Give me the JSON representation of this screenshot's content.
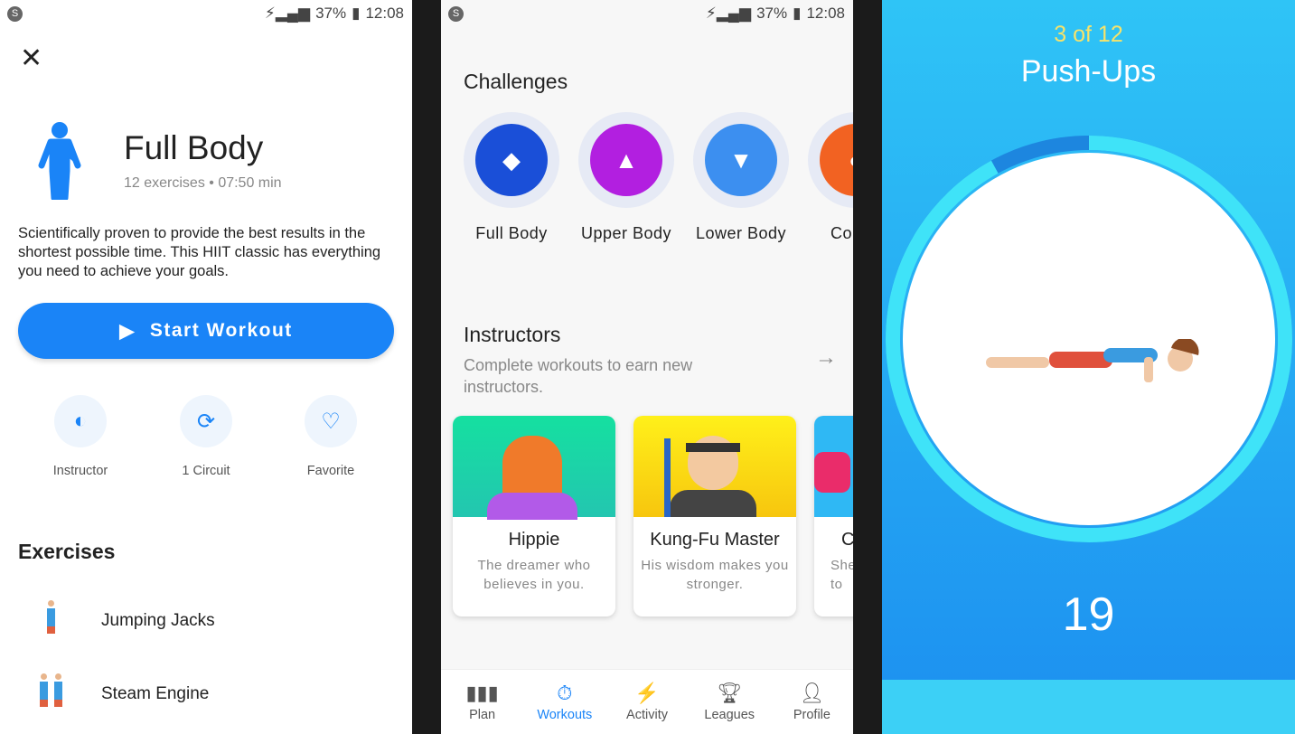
{
  "status_bar": {
    "battery": "37%",
    "time": "12:08"
  },
  "workout_detail": {
    "title": "Full Body",
    "subtitle": "12 exercises • 07:50 min",
    "description": "Scientifically proven to provide the best results in the shortest possible time. This HIIT classic has everything you need to achieve your goals.",
    "start_button": "Start Workout",
    "actions": [
      {
        "label": "Instructor",
        "icon": "visor-icon"
      },
      {
        "label": "1 Circuit",
        "icon": "refresh-icon"
      },
      {
        "label": "Favorite",
        "icon": "heart-icon"
      }
    ],
    "exercises_heading": "Exercises",
    "exercises": [
      {
        "name": "Jumping Jacks"
      },
      {
        "name": "Steam Engine"
      }
    ]
  },
  "workouts": {
    "challenges_heading": "Challenges",
    "challenges": [
      {
        "label": "Full Body",
        "color": "#1a4fd8"
      },
      {
        "label": "Upper Body",
        "color": "#b21fe0"
      },
      {
        "label": "Lower Body",
        "color": "#3c8ff0"
      },
      {
        "label": "Co",
        "color": "#f26222"
      }
    ],
    "instructors_heading": "Instructors",
    "instructors_sub": "Complete workouts to earn new instructors.",
    "instructors": [
      {
        "name": "Hippie",
        "desc": "The dreamer who believes in you.",
        "color": "#19d9a5"
      },
      {
        "name": "Kung-Fu Master",
        "desc": "His wisdom makes you stronger.",
        "color": "#fbe31a"
      },
      {
        "name": "C",
        "desc": "She to",
        "color": "#2fb8f4"
      }
    ],
    "nav": [
      {
        "label": "Plan",
        "icon": "plan-icon"
      },
      {
        "label": "Workouts",
        "icon": "stopwatch-icon",
        "active": true
      },
      {
        "label": "Activity",
        "icon": "lightning-icon"
      },
      {
        "label": "Leagues",
        "icon": "trophy-icon"
      },
      {
        "label": "Profile",
        "icon": "person-icon"
      }
    ]
  },
  "exercise_player": {
    "progress_label": "3 of 12",
    "exercise": "Push-Ups",
    "count": "19",
    "timer_progress": 0.92
  }
}
